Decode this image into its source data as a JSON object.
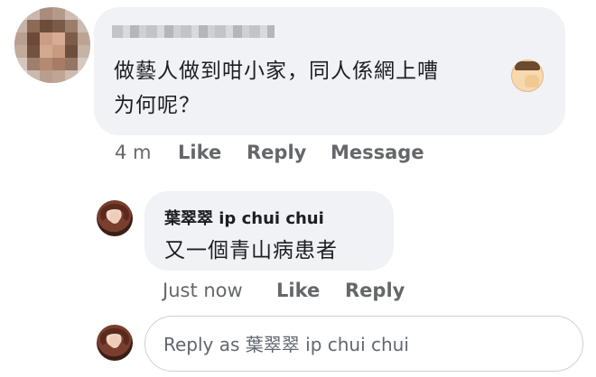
{
  "comment": {
    "author": "",
    "text_line1": "做藝人做到咁小家，同人係網上嘈",
    "text_line2": "为何呢？",
    "emoji": "face-palm-icon",
    "time": "4 m",
    "like_label": "Like",
    "reply_label": "Reply",
    "message_label": "Message"
  },
  "reply": {
    "author": "葉翠翠 ip chui chui",
    "text": "又一個青山病患者",
    "time": "Just now",
    "like_label": "Like",
    "reply_label": "Reply"
  },
  "reply_box": {
    "placeholder": "Reply as 葉翠翠 ip chui chui"
  },
  "colors": {
    "bubble": "#f0f2f5",
    "meta_text": "#65676b",
    "border": "#ccd0d5"
  }
}
